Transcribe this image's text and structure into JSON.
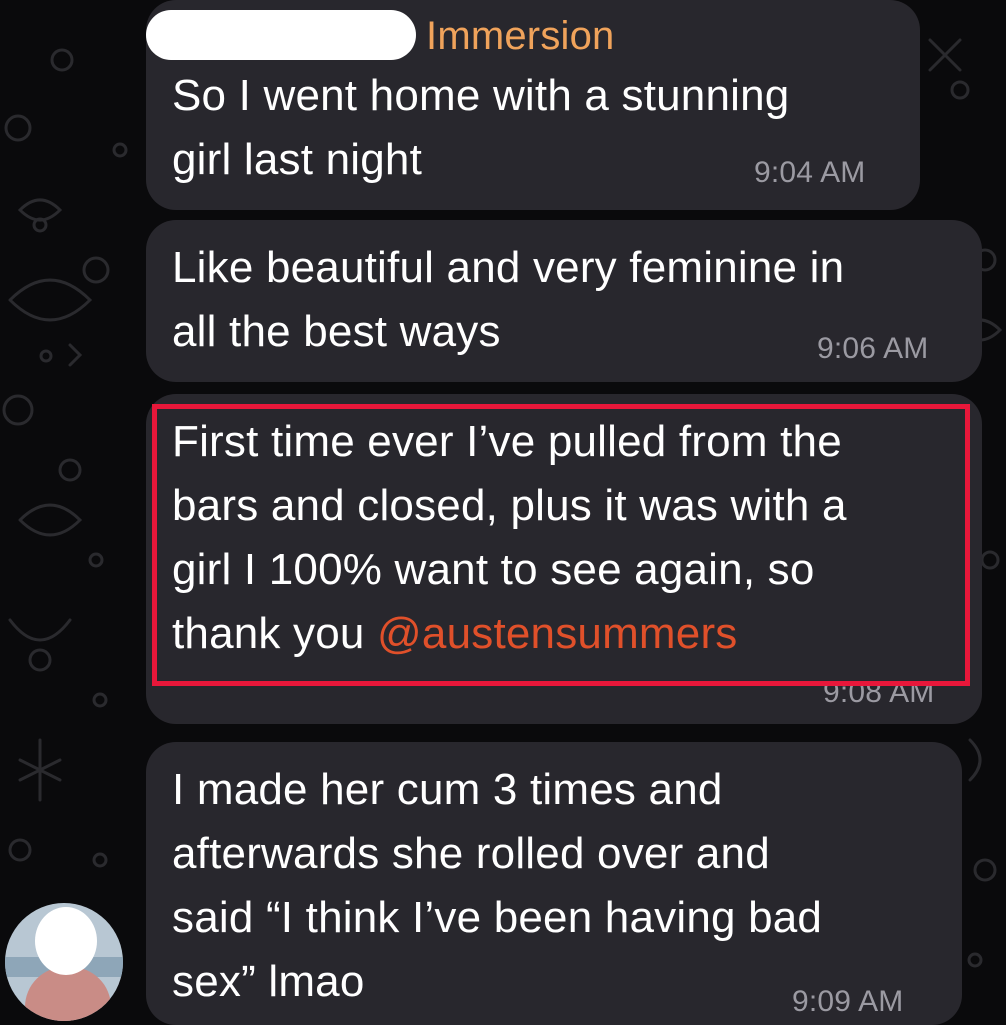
{
  "chat": {
    "sender": {
      "name": "Immersion",
      "redacted": true,
      "color": "#f0a35b"
    },
    "messages": [
      {
        "lines": [
          "So I went home with a stunning",
          "girl last night"
        ],
        "time": "9:04 AM"
      },
      {
        "lines": [
          "Like beautiful and very feminine in",
          "all the best ways"
        ],
        "time": "9:06 AM"
      },
      {
        "lines": [
          "First time ever I’ve pulled from the",
          "bars and closed, plus it was with a",
          "girl I 100% want to see again, so",
          "thank you "
        ],
        "mention": "@austensummers",
        "time": "9:08 AM",
        "highlighted": true
      },
      {
        "lines": [
          "I made her cum 3 times and",
          "afterwards she rolled over and",
          "said “I think I’ve been having bad",
          "sex” lmao"
        ],
        "time": "9:09 AM"
      }
    ]
  },
  "colors": {
    "bubble": "#28272d",
    "mention": "#e0502a",
    "highlight_border": "#e8173a",
    "timestamp": "#9b9aa2"
  },
  "icons": {
    "background": "doodle-pattern",
    "avatar": "user-avatar"
  }
}
